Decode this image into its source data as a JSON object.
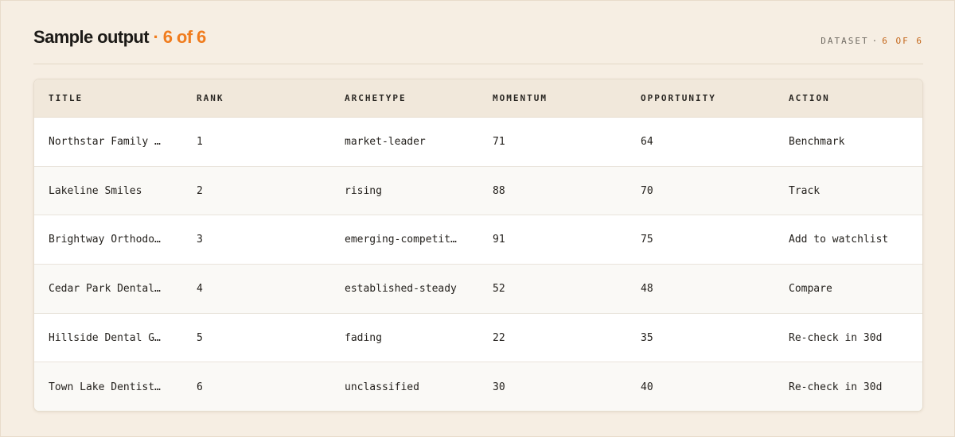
{
  "header": {
    "title": "Sample output",
    "separator": "·",
    "count": "6 of 6",
    "dataset_label": "DATASET",
    "dataset_separator": "·",
    "dataset_value": "6 OF 6"
  },
  "colors": {
    "accent": "#f07c1e",
    "accent_dark": "#c4671b",
    "background": "#f6eee3",
    "header_row": "#f1e8db"
  },
  "table": {
    "columns": [
      "TITLE",
      "RANK",
      "ARCHETYPE",
      "MOMENTUM",
      "OPPORTUNITY",
      "ACTION"
    ],
    "rows": [
      [
        "Northstar Family …",
        "1",
        "market-leader",
        "71",
        "64",
        "Benchmark"
      ],
      [
        "Lakeline Smiles",
        "2",
        "rising",
        "88",
        "70",
        "Track"
      ],
      [
        "Brightway Orthodo…",
        "3",
        "emerging-competit…",
        "91",
        "75",
        "Add to watchlist"
      ],
      [
        "Cedar Park Dental…",
        "4",
        "established-steady",
        "52",
        "48",
        "Compare"
      ],
      [
        "Hillside Dental G…",
        "5",
        "fading",
        "22",
        "35",
        "Re-check in 30d"
      ],
      [
        "Town Lake Dentist…",
        "6",
        "unclassified",
        "30",
        "40",
        "Re-check in 30d"
      ]
    ]
  }
}
